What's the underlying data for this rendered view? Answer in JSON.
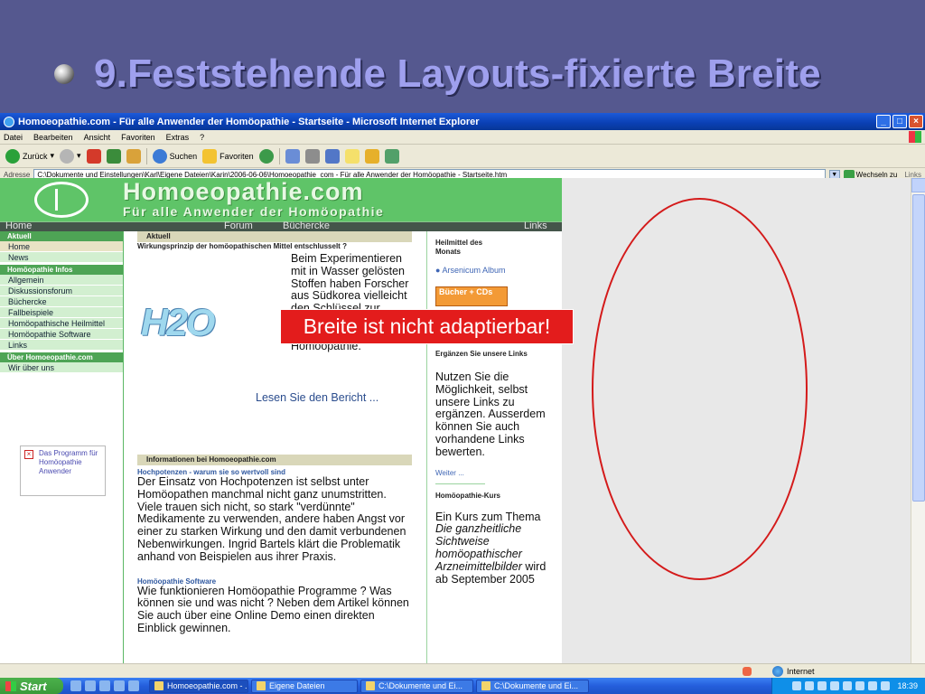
{
  "slide": {
    "title": "9.Feststehende Layouts-fixierte Breite"
  },
  "window": {
    "title": "Homoeopathie.com - Für alle Anwender der Homöopathie - Startseite - Microsoft Internet Explorer"
  },
  "menu": [
    "Datei",
    "Bearbeiten",
    "Ansicht",
    "Favoriten",
    "Extras",
    "?"
  ],
  "toolbar": {
    "back": "Zurück",
    "search": "Suchen",
    "favorites": "Favoriten"
  },
  "address": {
    "label": "Adresse",
    "value": "C:\\Dokumente und Einstellungen\\Karl\\Eigene Dateien\\Karin\\2006-06-06\\Homoeopathie_com - Für alle Anwender der Homöopathie - Startseite.htm",
    "go": "Wechseln zu",
    "links": "Links"
  },
  "site": {
    "name": "Homoeopathie.com",
    "tagline": "Für alle Anwender der Homöopathie",
    "nav": [
      "Home",
      "Forum",
      "Büchercke",
      "Links"
    ]
  },
  "leftnav": {
    "sections": [
      {
        "head": "Aktuell",
        "items": [
          "Home",
          "News"
        ]
      },
      {
        "head": "Homöopathie Infos",
        "items": [
          "Allgemein",
          "Diskussionsforum",
          "Büchercke",
          "Fallbeispiele",
          "Homöopathische Heilmittel",
          "Homöopathie Software",
          "Links"
        ]
      },
      {
        "head": "Über Homoeopathie.com",
        "items": [
          "Wir über uns"
        ]
      }
    ],
    "missing_image_alt": "Das Programm für Homöopathie Anwender"
  },
  "main": {
    "box1_head": "Aktuell",
    "box1_sub": "Wirkungsprinzip der homöopathischen Mittel entschlusselt ?",
    "h2o": "H2O",
    "teaser_text": "Beim Experimentieren mit in Wasser gelösten Stoffen haben Forscher aus Südkorea vielleicht den Schlüssel zur wissenschaftlichen Anerkennung der Homöopathie.",
    "teaser_link": "Lesen Sie den Bericht ...",
    "box2_head": "Informationen bei Homoeopathie.com",
    "hochpot_link": "Hochpotenzen - warum sie so wertvoll sind",
    "hochpot_text": "Der Einsatz von Hochpotenzen ist selbst unter Homöopathen manchmal nicht ganz unumstritten. Viele trauen sich nicht, so stark \"verdünnte\" Medikamente zu verwenden, andere haben Angst vor einer zu starken Wirkung und den damit verbundenen Nebenwirkungen. Ingrid Bartels klärt die Problematik anhand von Beispielen aus ihrer Praxis.",
    "software_link": "Homöopathie Software",
    "software_text": "Wie funktionieren Homöopathie Programme ? Was können sie und was nicht ? Neben dem Artikel können Sie auch über eine Online Demo einen direkten Einblick gewinnen."
  },
  "right": {
    "head1": "Heilmittel des Monats",
    "remedy": "Arsenicum Album",
    "banner": "Bücher + CDs",
    "head2": "Ergänzen Sie unsere Links",
    "text2": "Nutzen Sie die Möglichkeit, selbst unsere Links zu ergänzen. Ausserdem können Sie auch vorhandene Links bewerten.",
    "more": "Weiter ...",
    "head3": "Homöopathie-Kurs",
    "text3_a": "Ein Kurs zum Thema ",
    "text3_b": "Die ganzheitliche Sichtweise homöopathischer Arzneimittelbilder",
    "text3_c": " wird ab September 2005"
  },
  "callout": "Breite ist nicht adaptierbar!",
  "status": {
    "zone": "Internet"
  },
  "taskbar": {
    "start": "Start",
    "tasks": [
      "Homoeopathie.com - ...",
      "Eigene Dateien",
      "C:\\Dokumente und Ei...",
      "C:\\Dokumente und Ei..."
    ],
    "clock": "18:39"
  },
  "colors": {
    "slide_bg": "#55588f",
    "title": "#9fa0ee",
    "site_green": "#5fc468",
    "callout": "#e31c1c",
    "ellipse": "#d41a1a"
  }
}
